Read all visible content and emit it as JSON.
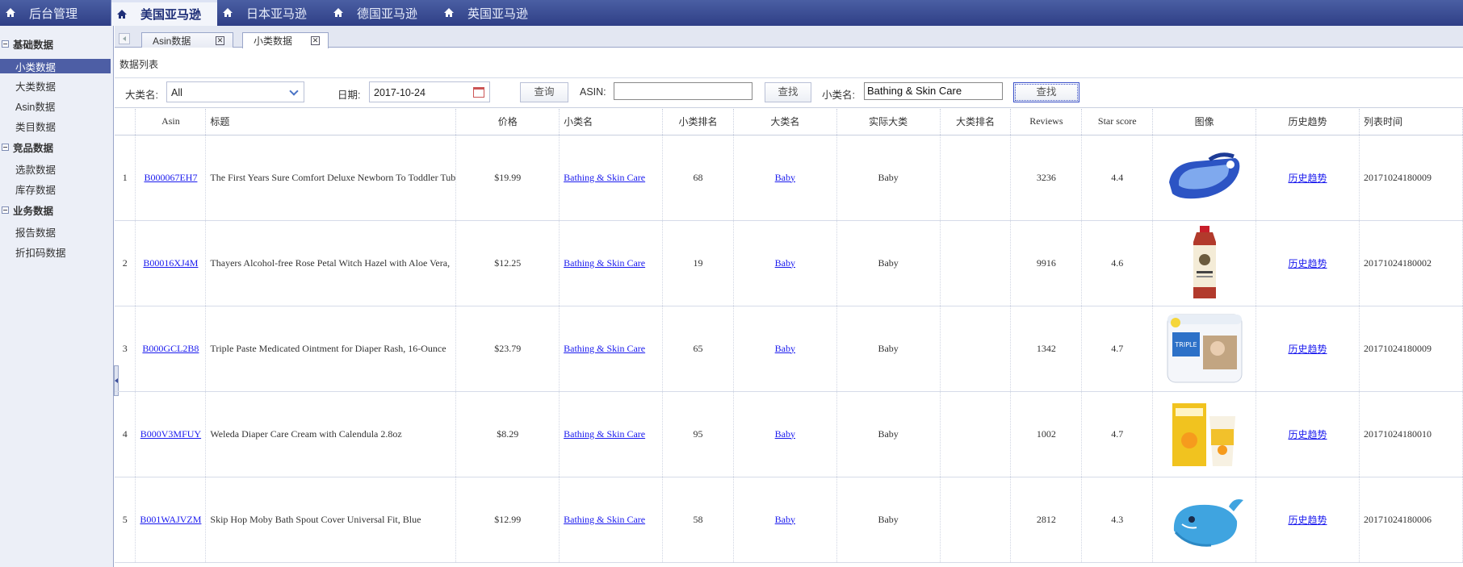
{
  "topnav": {
    "tabs": [
      {
        "label": "后台管理"
      },
      {
        "label": "美国亚马逊"
      },
      {
        "label": "日本亚马逊"
      },
      {
        "label": "德国亚马逊"
      },
      {
        "label": "英国亚马逊"
      }
    ],
    "active_index": 1
  },
  "sidebar": {
    "groups": [
      {
        "label": "基础数据",
        "items": [
          "小类数据",
          "大类数据",
          "Asin数据",
          "类目数据"
        ]
      },
      {
        "label": "竞品数据",
        "items": [
          "选款数据",
          "库存数据"
        ]
      },
      {
        "label": "业务数据",
        "items": [
          "报告数据",
          "折扣码数据"
        ]
      }
    ],
    "selected": "小类数据"
  },
  "page_tabs": [
    {
      "label": "Asin数据"
    },
    {
      "label": "小类数据"
    }
  ],
  "panel_title": "数据列表",
  "filters": {
    "category_label": "大类名:",
    "category_value": "All",
    "date_label": "日期:",
    "date_value": "2017-10-24",
    "query_button": "查询",
    "asin_label": "ASIN:",
    "asin_value": "",
    "find_button": "查找",
    "subcat_label": "小类名:",
    "subcat_value": "Bathing & Skin Care",
    "find_button2": "查找"
  },
  "table": {
    "headers": [
      "",
      "Asin",
      "标题",
      "价格",
      "小类名",
      "小类排名",
      "大类名",
      "实际大类",
      "大类排名",
      "Reviews",
      "Star score",
      "图像",
      "历史趋势",
      "列表时间"
    ],
    "rows": [
      {
        "n": "1",
        "asin": "B000067EH7",
        "title": "The First Years Sure Comfort Deluxe Newborn To Toddler Tub",
        "price": "$19.99",
        "subcat": "Bathing & Skin Care",
        "subrank": "68",
        "cat": "Baby",
        "realcat": "Baby",
        "catrank": "",
        "reviews": "3236",
        "star": "4.4",
        "image": "baby-tub",
        "trend": "历史趋势",
        "time": "20171024180009"
      },
      {
        "n": "2",
        "asin": "B00016XJ4M",
        "title": "Thayers Alcohol-free Rose Petal Witch Hazel with Aloe Vera,",
        "price": "$12.25",
        "subcat": "Bathing & Skin Care",
        "subrank": "19",
        "cat": "Baby",
        "realcat": "Baby",
        "catrank": "",
        "reviews": "9916",
        "star": "4.6",
        "image": "witch-hazel-bottle",
        "trend": "历史趋势",
        "time": "20171024180002"
      },
      {
        "n": "3",
        "asin": "B000GCL2B8",
        "title": "Triple Paste Medicated Ointment for Diaper Rash, 16-Ounce",
        "price": "$23.79",
        "subcat": "Bathing & Skin Care",
        "subrank": "65",
        "cat": "Baby",
        "realcat": "Baby",
        "catrank": "",
        "reviews": "1342",
        "star": "4.7",
        "image": "ointment-tub",
        "trend": "历史趋势",
        "time": "20171024180009"
      },
      {
        "n": "4",
        "asin": "B000V3MFUY",
        "title": "Weleda Diaper Care Cream with Calendula 2.8oz",
        "price": "$8.29",
        "subcat": "Bathing & Skin Care",
        "subrank": "95",
        "cat": "Baby",
        "realcat": "Baby",
        "catrank": "",
        "reviews": "1002",
        "star": "4.7",
        "image": "cream-box",
        "trend": "历史趋势",
        "time": "20171024180010"
      },
      {
        "n": "5",
        "asin": "B001WAJVZM",
        "title": "Skip Hop Moby Bath Spout Cover Universal Fit, Blue",
        "price": "$12.99",
        "subcat": "Bathing & Skin Care",
        "subrank": "58",
        "cat": "Baby",
        "realcat": "Baby",
        "catrank": "",
        "reviews": "2812",
        "star": "4.3",
        "image": "whale-spout",
        "trend": "历史趋势",
        "time": "20171024180006"
      }
    ]
  },
  "colors": {
    "accent": "#3d4f9b",
    "link": "#1a1aee",
    "nav": "#2f3f86"
  }
}
